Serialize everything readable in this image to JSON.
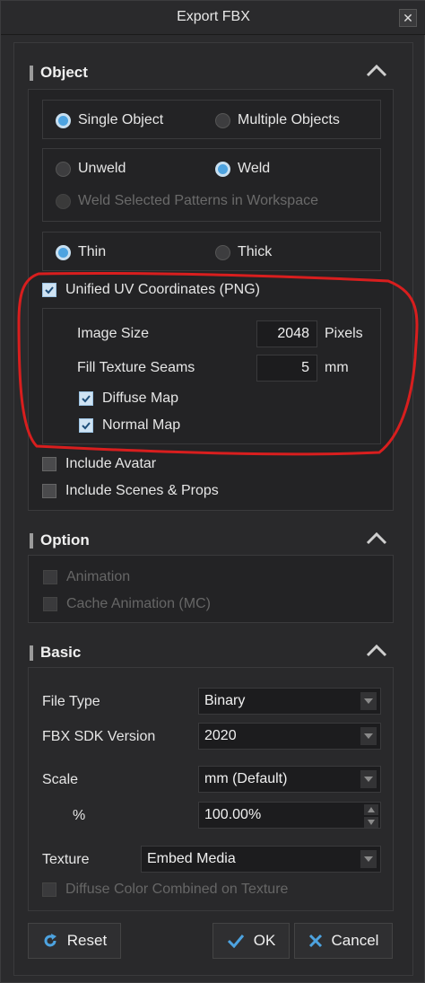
{
  "window": {
    "title": "Export FBX",
    "close_glyph": "✕"
  },
  "sections": {
    "object": {
      "label": "Object",
      "object_mode": {
        "options": [
          "Single Object",
          "Multiple Objects"
        ],
        "selected": 0
      },
      "weld_mode": {
        "options": [
          "Unweld",
          "Weld"
        ],
        "selected": 1
      },
      "weld_selected": "Weld Selected Patterns in Workspace",
      "thickness": {
        "options": [
          "Thin",
          "Thick"
        ],
        "selected": 0
      },
      "unified_uv": {
        "label": "Unified UV Coordinates (PNG)",
        "checked": true
      },
      "image_size": {
        "label": "Image Size",
        "value": "2048",
        "unit": "Pixels"
      },
      "fill_seams": {
        "label": "Fill Texture Seams",
        "value": "5",
        "unit": "mm"
      },
      "diffuse_map": {
        "label": "Diffuse Map",
        "checked": true
      },
      "normal_map": {
        "label": "Normal Map",
        "checked": true
      },
      "include_avatar": {
        "label": "Include Avatar",
        "checked": false
      },
      "include_scenes": {
        "label": "Include Scenes & Props",
        "checked": false
      }
    },
    "option": {
      "label": "Option",
      "animation": {
        "label": "Animation",
        "checked": false
      },
      "cache_animation": {
        "label": "Cache Animation (MC)",
        "checked": false
      }
    },
    "basic": {
      "label": "Basic",
      "file_type": {
        "label": "File Type",
        "value": "Binary"
      },
      "sdk_version": {
        "label": "FBX SDK Version",
        "value": "2020"
      },
      "scale": {
        "label": "Scale",
        "value": "mm (Default)"
      },
      "percent": {
        "label": "%",
        "value": "100.00%"
      },
      "texture": {
        "label": "Texture",
        "value": "Embed Media"
      },
      "diffuse_combined": {
        "label": "Diffuse Color Combined on Texture",
        "checked": false
      }
    }
  },
  "buttons": {
    "reset": "Reset",
    "ok": "OK",
    "cancel": "Cancel"
  },
  "colors": {
    "accent": "#4da3e0",
    "annotation": "#d81e1e",
    "background": "#2b2b2d"
  },
  "icons": [
    "close-icon",
    "chevron-up-icon",
    "chevron-down-icon",
    "check-icon",
    "reset-icon",
    "ok-check-icon",
    "cancel-x-icon"
  ]
}
